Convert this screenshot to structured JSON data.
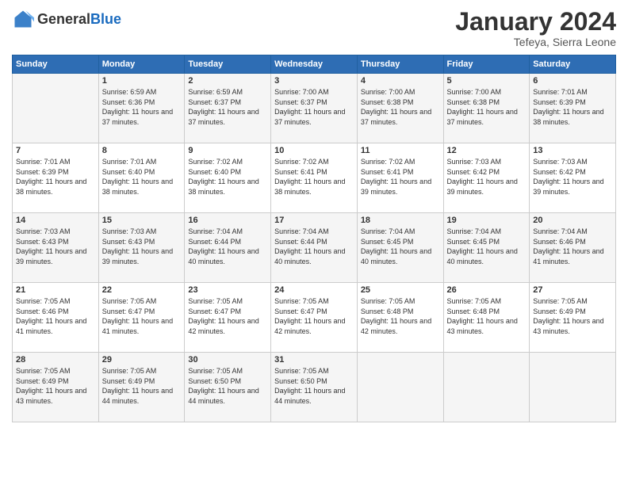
{
  "header": {
    "logo_general": "General",
    "logo_blue": "Blue",
    "month_title": "January 2024",
    "subtitle": "Tefeya, Sierra Leone"
  },
  "days_of_week": [
    "Sunday",
    "Monday",
    "Tuesday",
    "Wednesday",
    "Thursday",
    "Friday",
    "Saturday"
  ],
  "weeks": [
    [
      {
        "day": "",
        "sunrise": "",
        "sunset": "",
        "daylight": ""
      },
      {
        "day": "1",
        "sunrise": "6:59 AM",
        "sunset": "6:36 PM",
        "daylight": "11 hours and 37 minutes."
      },
      {
        "day": "2",
        "sunrise": "6:59 AM",
        "sunset": "6:37 PM",
        "daylight": "11 hours and 37 minutes."
      },
      {
        "day": "3",
        "sunrise": "7:00 AM",
        "sunset": "6:37 PM",
        "daylight": "11 hours and 37 minutes."
      },
      {
        "day": "4",
        "sunrise": "7:00 AM",
        "sunset": "6:38 PM",
        "daylight": "11 hours and 37 minutes."
      },
      {
        "day": "5",
        "sunrise": "7:00 AM",
        "sunset": "6:38 PM",
        "daylight": "11 hours and 37 minutes."
      },
      {
        "day": "6",
        "sunrise": "7:01 AM",
        "sunset": "6:39 PM",
        "daylight": "11 hours and 38 minutes."
      }
    ],
    [
      {
        "day": "7",
        "sunrise": "7:01 AM",
        "sunset": "6:39 PM",
        "daylight": "11 hours and 38 minutes."
      },
      {
        "day": "8",
        "sunrise": "7:01 AM",
        "sunset": "6:40 PM",
        "daylight": "11 hours and 38 minutes."
      },
      {
        "day": "9",
        "sunrise": "7:02 AM",
        "sunset": "6:40 PM",
        "daylight": "11 hours and 38 minutes."
      },
      {
        "day": "10",
        "sunrise": "7:02 AM",
        "sunset": "6:41 PM",
        "daylight": "11 hours and 38 minutes."
      },
      {
        "day": "11",
        "sunrise": "7:02 AM",
        "sunset": "6:41 PM",
        "daylight": "11 hours and 39 minutes."
      },
      {
        "day": "12",
        "sunrise": "7:03 AM",
        "sunset": "6:42 PM",
        "daylight": "11 hours and 39 minutes."
      },
      {
        "day": "13",
        "sunrise": "7:03 AM",
        "sunset": "6:42 PM",
        "daylight": "11 hours and 39 minutes."
      }
    ],
    [
      {
        "day": "14",
        "sunrise": "7:03 AM",
        "sunset": "6:43 PM",
        "daylight": "11 hours and 39 minutes."
      },
      {
        "day": "15",
        "sunrise": "7:03 AM",
        "sunset": "6:43 PM",
        "daylight": "11 hours and 39 minutes."
      },
      {
        "day": "16",
        "sunrise": "7:04 AM",
        "sunset": "6:44 PM",
        "daylight": "11 hours and 40 minutes."
      },
      {
        "day": "17",
        "sunrise": "7:04 AM",
        "sunset": "6:44 PM",
        "daylight": "11 hours and 40 minutes."
      },
      {
        "day": "18",
        "sunrise": "7:04 AM",
        "sunset": "6:45 PM",
        "daylight": "11 hours and 40 minutes."
      },
      {
        "day": "19",
        "sunrise": "7:04 AM",
        "sunset": "6:45 PM",
        "daylight": "11 hours and 40 minutes."
      },
      {
        "day": "20",
        "sunrise": "7:04 AM",
        "sunset": "6:46 PM",
        "daylight": "11 hours and 41 minutes."
      }
    ],
    [
      {
        "day": "21",
        "sunrise": "7:05 AM",
        "sunset": "6:46 PM",
        "daylight": "11 hours and 41 minutes."
      },
      {
        "day": "22",
        "sunrise": "7:05 AM",
        "sunset": "6:47 PM",
        "daylight": "11 hours and 41 minutes."
      },
      {
        "day": "23",
        "sunrise": "7:05 AM",
        "sunset": "6:47 PM",
        "daylight": "11 hours and 42 minutes."
      },
      {
        "day": "24",
        "sunrise": "7:05 AM",
        "sunset": "6:47 PM",
        "daylight": "11 hours and 42 minutes."
      },
      {
        "day": "25",
        "sunrise": "7:05 AM",
        "sunset": "6:48 PM",
        "daylight": "11 hours and 42 minutes."
      },
      {
        "day": "26",
        "sunrise": "7:05 AM",
        "sunset": "6:48 PM",
        "daylight": "11 hours and 43 minutes."
      },
      {
        "day": "27",
        "sunrise": "7:05 AM",
        "sunset": "6:49 PM",
        "daylight": "11 hours and 43 minutes."
      }
    ],
    [
      {
        "day": "28",
        "sunrise": "7:05 AM",
        "sunset": "6:49 PM",
        "daylight": "11 hours and 43 minutes."
      },
      {
        "day": "29",
        "sunrise": "7:05 AM",
        "sunset": "6:49 PM",
        "daylight": "11 hours and 44 minutes."
      },
      {
        "day": "30",
        "sunrise": "7:05 AM",
        "sunset": "6:50 PM",
        "daylight": "11 hours and 44 minutes."
      },
      {
        "day": "31",
        "sunrise": "7:05 AM",
        "sunset": "6:50 PM",
        "daylight": "11 hours and 44 minutes."
      },
      {
        "day": "",
        "sunrise": "",
        "sunset": "",
        "daylight": ""
      },
      {
        "day": "",
        "sunrise": "",
        "sunset": "",
        "daylight": ""
      },
      {
        "day": "",
        "sunrise": "",
        "sunset": "",
        "daylight": ""
      }
    ]
  ]
}
